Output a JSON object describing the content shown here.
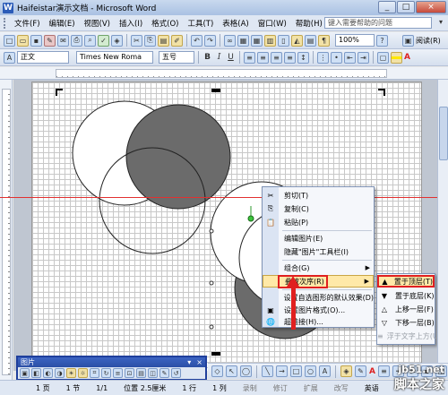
{
  "window": {
    "icon_letter": "W",
    "title": "Haifeistar演示文档 - Microsoft Word",
    "buttons": [
      "_",
      "□",
      "×"
    ]
  },
  "menubar": {
    "items": [
      "文件(F)",
      "编辑(E)",
      "视图(V)",
      "插入(I)",
      "格式(O)",
      "工具(T)",
      "表格(A)",
      "窗口(W)",
      "帮助(H)"
    ],
    "help_placeholder": "键入需要帮助的问题"
  },
  "toolbar_standard": {
    "zoom": "100%",
    "read_label": "阅读(R)"
  },
  "toolbar_format": {
    "style": "正文",
    "font": "Times New Roma",
    "size": "五号",
    "bold": "B",
    "italic": "I",
    "underline": "U",
    "font_color_letter": "A"
  },
  "colors": {
    "accent_red": "#e02020",
    "shape_fill_dark": "#6b6b6b",
    "menu_highlight": "#ffe9a8"
  },
  "context_menu": {
    "items": [
      {
        "label": "剪切(T)",
        "icon": "scissors-icon",
        "glyph": "✂"
      },
      {
        "label": "复制(C)",
        "icon": "copy-icon",
        "glyph": "⎘"
      },
      {
        "label": "粘贴(P)",
        "icon": "paste-icon",
        "glyph": "📋"
      },
      {
        "label": "编辑图片(E)",
        "icon": "",
        "glyph": ""
      },
      {
        "label": "隐藏\"图片\"工具栏(I)",
        "icon": "",
        "glyph": ""
      },
      {
        "label": "组合(G)",
        "icon": "",
        "glyph": ""
      },
      {
        "label": "叠放次序(R)",
        "icon": "",
        "glyph": ""
      },
      {
        "label": "设置自选图形的默认效果(D)",
        "icon": "",
        "glyph": ""
      },
      {
        "label": "设置图片格式(O)...",
        "icon": "format-picture-icon",
        "glyph": "▣"
      },
      {
        "label": "超链接(H)...",
        "icon": "hyperlink-icon",
        "glyph": "🌐"
      }
    ]
  },
  "submenu": {
    "items": [
      {
        "label": "置于顶层(T)",
        "glyph": "▲",
        "disabled": false
      },
      {
        "label": "置于底层(K)",
        "glyph": "▼",
        "disabled": false
      },
      {
        "label": "上移一层(F)",
        "glyph": "△",
        "disabled": false
      },
      {
        "label": "下移一层(B)",
        "glyph": "▽",
        "disabled": false
      },
      {
        "label": "浮于文字上方(U)",
        "glyph": "≡",
        "disabled": true
      }
    ]
  },
  "picture_toolbar": {
    "title": "图片",
    "controls": [
      "▾",
      "×"
    ]
  },
  "statusbar": {
    "page": "1 页",
    "section": "1 节",
    "pages": "1/1",
    "position": "位置 2.5厘米",
    "line": "1 行",
    "col": "1 列",
    "rec": "录制",
    "track": "修订",
    "ext": "扩展",
    "ovr": "改写",
    "lang": "英语"
  },
  "watermark": {
    "url": "jb51.net",
    "name": "脚本之家"
  }
}
